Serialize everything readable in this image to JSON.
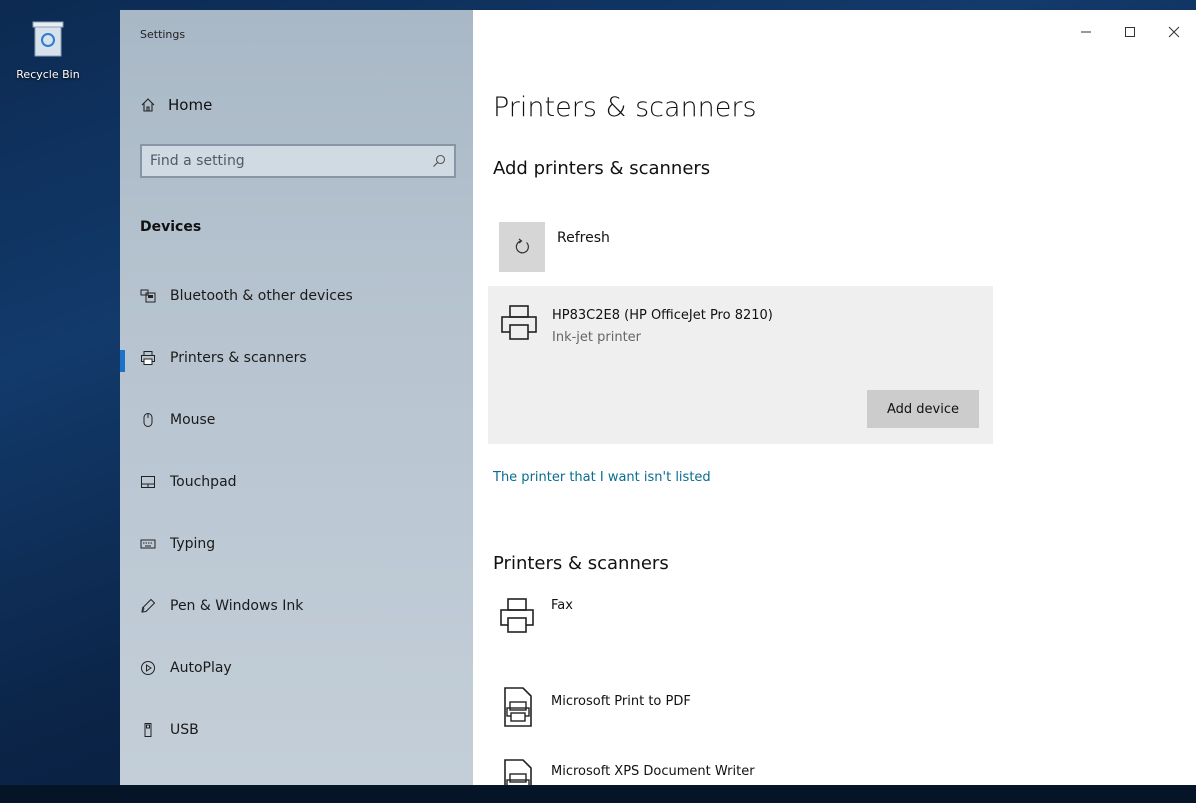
{
  "desktop": {
    "recycle_bin_label": "Recycle Bin"
  },
  "window": {
    "app_title": "Settings",
    "controls": [
      "minimize",
      "maximize",
      "close"
    ]
  },
  "sidebar": {
    "home_label": "Home",
    "search_placeholder": "Find a setting",
    "section": "Devices",
    "items": [
      {
        "label": "Bluetooth & other devices",
        "icon": "bluetooth-devices-icon",
        "active": false
      },
      {
        "label": "Printers & scanners",
        "icon": "printer-icon",
        "active": true
      },
      {
        "label": "Mouse",
        "icon": "mouse-icon",
        "active": false
      },
      {
        "label": "Touchpad",
        "icon": "touchpad-icon",
        "active": false
      },
      {
        "label": "Typing",
        "icon": "keyboard-icon",
        "active": false
      },
      {
        "label": "Pen & Windows Ink",
        "icon": "pen-icon",
        "active": false
      },
      {
        "label": "AutoPlay",
        "icon": "autoplay-icon",
        "active": false
      },
      {
        "label": "USB",
        "icon": "usb-icon",
        "active": false
      }
    ]
  },
  "main": {
    "title": "Printers & scanners",
    "add_section": "Add printers & scanners",
    "refresh_label": "Refresh",
    "found_device": {
      "name": "HP83C2E8 (HP OfficeJet Pro 8210)",
      "type": "Ink-jet printer",
      "add_button": "Add device"
    },
    "not_listed_link": "The printer that I want isn't listed",
    "list_section": "Printers & scanners",
    "printers": [
      {
        "name": "Fax"
      },
      {
        "name": "Microsoft Print to PDF"
      },
      {
        "name": "Microsoft XPS Document Writer"
      }
    ]
  },
  "colors": {
    "accent": "#1a73c9",
    "link": "#0a6c8f",
    "sidebar_bg": "#b7c4d0",
    "device_card_bg": "#efefef",
    "button_bg": "#cccccc"
  }
}
